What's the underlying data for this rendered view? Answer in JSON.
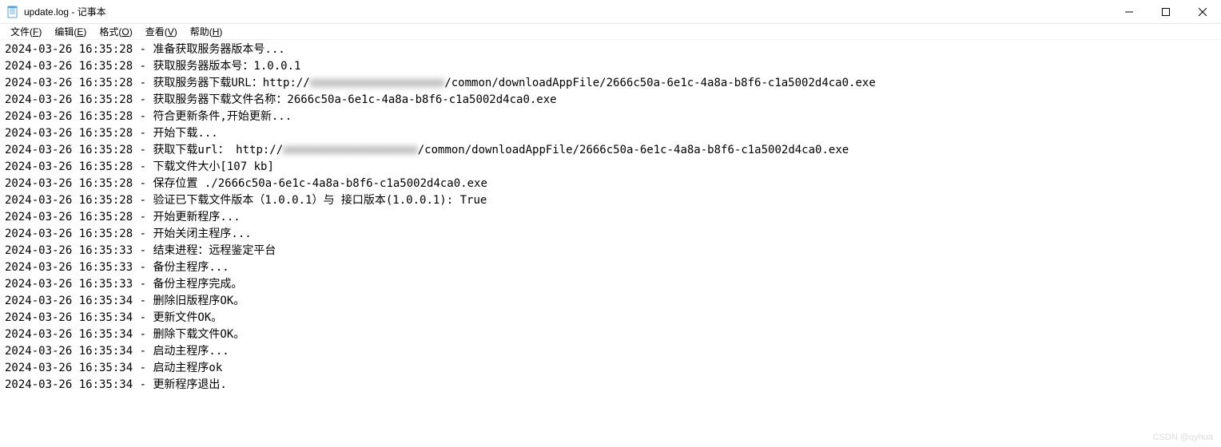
{
  "window": {
    "title": "update.log - 记事本"
  },
  "menu": {
    "file": "文件(F)",
    "edit": "编辑(E)",
    "format": "格式(O)",
    "view": "查看(V)",
    "help": "帮助(H)"
  },
  "log_lines": [
    {
      "ts": "2024-03-26 16:35:28",
      "msg_pre": "准备获取服务器版本号...",
      "blur": "",
      "msg_post": ""
    },
    {
      "ts": "2024-03-26 16:35:28",
      "msg_pre": "获取服务器版本号：1.0.0.1",
      "blur": "",
      "msg_post": ""
    },
    {
      "ts": "2024-03-26 16:35:28",
      "msg_pre": "获取服务器下载URL：http://",
      "blur": "xxxxxxxxxxxxxxxxxxxx",
      "msg_post": "/common/downloadAppFile/2666c50a-6e1c-4a8a-b8f6-c1a5002d4ca0.exe"
    },
    {
      "ts": "2024-03-26 16:35:28",
      "msg_pre": "获取服务器下载文件名称：2666c50a-6e1c-4a8a-b8f6-c1a5002d4ca0.exe",
      "blur": "",
      "msg_post": ""
    },
    {
      "ts": "2024-03-26 16:35:28",
      "msg_pre": "符合更新条件,开始更新...",
      "blur": "",
      "msg_post": ""
    },
    {
      "ts": "2024-03-26 16:35:28",
      "msg_pre": "开始下载...",
      "blur": "",
      "msg_post": ""
    },
    {
      "ts": "2024-03-26 16:35:28",
      "msg_pre": "获取下载url： http://",
      "blur": "xxxxxxxxxxxxxxxxxxxx",
      "msg_post": "/common/downloadAppFile/2666c50a-6e1c-4a8a-b8f6-c1a5002d4ca0.exe"
    },
    {
      "ts": "2024-03-26 16:35:28",
      "msg_pre": "下载文件大小[107 kb]",
      "blur": "",
      "msg_post": ""
    },
    {
      "ts": "2024-03-26 16:35:28",
      "msg_pre": "保存位置 ./2666c50a-6e1c-4a8a-b8f6-c1a5002d4ca0.exe",
      "blur": "",
      "msg_post": ""
    },
    {
      "ts": "2024-03-26 16:35:28",
      "msg_pre": "验证已下载文件版本（1.0.0.1）与 接口版本(1.0.0.1): True",
      "blur": "",
      "msg_post": ""
    },
    {
      "ts": "2024-03-26 16:35:28",
      "msg_pre": "开始更新程序...",
      "blur": "",
      "msg_post": ""
    },
    {
      "ts": "2024-03-26 16:35:28",
      "msg_pre": "开始关闭主程序...",
      "blur": "",
      "msg_post": ""
    },
    {
      "ts": "2024-03-26 16:35:33",
      "msg_pre": "结束进程：远程鉴定平台",
      "blur": "",
      "msg_post": ""
    },
    {
      "ts": "2024-03-26 16:35:33",
      "msg_pre": "备份主程序...",
      "blur": "",
      "msg_post": ""
    },
    {
      "ts": "2024-03-26 16:35:33",
      "msg_pre": "备份主程序完成。",
      "blur": "",
      "msg_post": ""
    },
    {
      "ts": "2024-03-26 16:35:34",
      "msg_pre": "删除旧版程序OK。",
      "blur": "",
      "msg_post": ""
    },
    {
      "ts": "2024-03-26 16:35:34",
      "msg_pre": "更新文件OK。",
      "blur": "",
      "msg_post": ""
    },
    {
      "ts": "2024-03-26 16:35:34",
      "msg_pre": "删除下载文件OK。",
      "blur": "",
      "msg_post": ""
    },
    {
      "ts": "2024-03-26 16:35:34",
      "msg_pre": "启动主程序...",
      "blur": "",
      "msg_post": ""
    },
    {
      "ts": "2024-03-26 16:35:34",
      "msg_pre": "启动主程序ok",
      "blur": "",
      "msg_post": ""
    },
    {
      "ts": "2024-03-26 16:35:34",
      "msg_pre": "更新程序退出.",
      "blur": "",
      "msg_post": ""
    }
  ],
  "watermark": "CSDN @qyhua"
}
